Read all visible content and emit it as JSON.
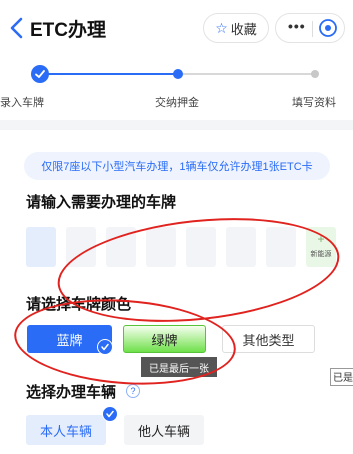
{
  "header": {
    "title": "ETC办理",
    "favorite_label": "收藏",
    "more_label": "•••"
  },
  "steps": [
    {
      "label": "录入车牌",
      "state": "done"
    },
    {
      "label": "交纳押金",
      "state": "current"
    },
    {
      "label": "填写资料",
      "state": "todo"
    }
  ],
  "notice": "仅限7座以下小型汽车办理，1辆车仅允许办理1张ETC卡",
  "plate_section": {
    "title": "请输入需要办理的车牌",
    "new_energy_plus": "+",
    "new_energy_label": "新能源"
  },
  "color_section": {
    "title": "请选择车牌颜色",
    "options": [
      {
        "label": "蓝牌",
        "selected": true,
        "color": "#2a6cf6"
      },
      {
        "label": "绿牌",
        "selected": false,
        "color": "#6fe04a"
      },
      {
        "label": "其他类型",
        "selected": false
      }
    ],
    "tooltip": "已是最后一张",
    "edge_tooltip": "已是"
  },
  "vehicle_section": {
    "title": "选择办理车辆",
    "help_icon": "?",
    "options": [
      {
        "label": "本人车辆",
        "selected": true
      },
      {
        "label": "他人车辆",
        "selected": false
      }
    ]
  },
  "colors": {
    "accent": "#2a6cf6",
    "annotation_red": "#e0231f"
  }
}
